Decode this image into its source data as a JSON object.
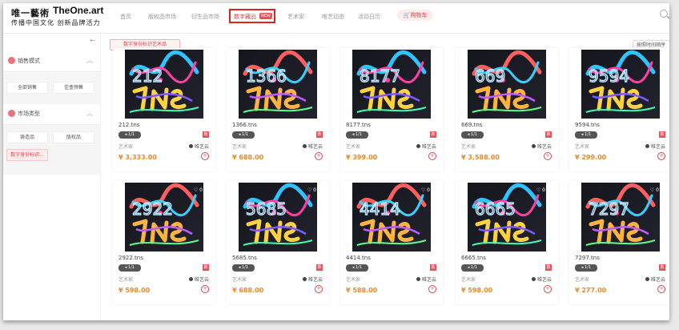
{
  "header": {
    "logo_cn": "唯一藝術",
    "logo_en": "TheOne.art",
    "slogan": "传播中国文化  创新品牌活力",
    "nav": [
      {
        "label": "首页"
      },
      {
        "label": "版权品市场"
      },
      {
        "label": "衍生品市场"
      },
      {
        "label": "艺术家"
      },
      {
        "label": "唯艺动态"
      },
      {
        "label": "活动日历"
      }
    ],
    "active_nav": {
      "label": "数字藏品",
      "badge": "NEW"
    },
    "cart_label": "购物车",
    "search_icon": "search-icon",
    "accent": "#e0404a"
  },
  "sidebar": {
    "collapse_icon": "arrow-left-icon",
    "sections": [
      {
        "title": "销售模式",
        "icon": "sale-mode-icon",
        "chips": [
          {
            "label": "全部销售",
            "selected": false
          },
          {
            "label": "佳盒预售",
            "selected": false
          }
        ]
      },
      {
        "title": "市场类型",
        "icon": "market-type-icon",
        "chips": [
          {
            "label": "铸造品",
            "selected": false
          },
          {
            "label": "版权品",
            "selected": false
          },
          {
            "label": "数字身份标识...",
            "selected": true
          }
        ]
      }
    ]
  },
  "filter_tag": "数字身份标识艺术品",
  "sort_label": "按照时间顺序",
  "cards": [
    {
      "code": "212",
      "name": "212.tns",
      "edition": "1/1",
      "artist_label": "艺术家",
      "artist": "唯艺云",
      "price": "¥ 3,333.00",
      "likes": "",
      "badge": "数"
    },
    {
      "code": "1366",
      "name": "1366.tns",
      "edition": "1/1",
      "artist_label": "艺术家",
      "artist": "唯艺云",
      "price": "¥ 688.00",
      "likes": "",
      "badge": "数"
    },
    {
      "code": "8177",
      "name": "8177.tns",
      "edition": "1/1",
      "artist_label": "艺术家",
      "artist": "唯艺云",
      "price": "¥ 399.00",
      "likes": "",
      "badge": "数"
    },
    {
      "code": "669",
      "name": "669.tns",
      "edition": "1/1",
      "artist_label": "艺术家",
      "artist": "唯艺云",
      "price": "¥ 3,588.00",
      "likes": "",
      "badge": "数"
    },
    {
      "code": "9594",
      "name": "9594.tns",
      "edition": "1/1",
      "artist_label": "艺术家",
      "artist": "唯艺云",
      "price": "¥ 299.00",
      "likes": "",
      "badge": "数"
    },
    {
      "code": "2922",
      "name": "2922.tns",
      "edition": "1/1",
      "artist_label": "艺术家",
      "artist": "唯艺云",
      "price": "¥ 598.00",
      "likes": "0",
      "badge": "数"
    },
    {
      "code": "5685",
      "name": "5685.tns",
      "edition": "1/1",
      "artist_label": "艺术家",
      "artist": "唯艺云",
      "price": "¥ 688.00",
      "likes": "0",
      "badge": "数"
    },
    {
      "code": "4414",
      "name": "4414.tns",
      "edition": "1/1",
      "artist_label": "艺术家",
      "artist": "唯艺云",
      "price": "¥ 588.00",
      "likes": "0",
      "badge": "数"
    },
    {
      "code": "6665",
      "name": "6665.tns",
      "edition": "1/1",
      "artist_label": "艺术家",
      "artist": "唯艺云",
      "price": "¥ 598.00",
      "likes": "0",
      "badge": "数"
    },
    {
      "code": "7297",
      "name": "7297.tns",
      "edition": "1/1",
      "artist_label": "艺术家",
      "artist": "唯艺云",
      "price": "¥ 277.00",
      "likes": "0",
      "badge": "数"
    }
  ]
}
